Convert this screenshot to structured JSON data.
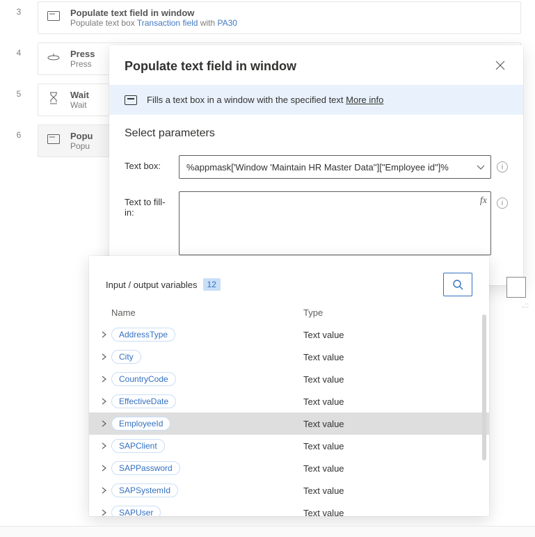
{
  "steps": [
    {
      "num": "3",
      "title": "Populate text field in window",
      "sub_prefix": "Populate text box ",
      "sub_link": "Transaction field",
      "sub_mid": " with ",
      "sub_link2": "PA30"
    },
    {
      "num": "4",
      "title": "Press",
      "sub_prefix": "Press"
    },
    {
      "num": "5",
      "title": "Wait",
      "sub_prefix": "Wait "
    },
    {
      "num": "6",
      "title": "Popu",
      "sub_prefix": "Popu"
    }
  ],
  "panel": {
    "title": "Populate text field in window",
    "info_text": "Fills a text box in a window with the specified text ",
    "info_link": "More info",
    "section": "Select parameters",
    "label_textbox": "Text box:",
    "value_textbox": "%appmask['Window 'Maintain HR Master Data''][\"Employee id\"]%",
    "label_fill": "Text to fill-in:",
    "value_fill": "",
    "fx": "fx"
  },
  "vardrop": {
    "title": "Input / output variables",
    "count": "12",
    "col_name": "Name",
    "col_type": "Type",
    "rows": [
      {
        "name": "AddressType",
        "type": "Text value",
        "sel": false
      },
      {
        "name": "City",
        "type": "Text value",
        "sel": false
      },
      {
        "name": "CountryCode",
        "type": "Text value",
        "sel": false
      },
      {
        "name": "EffectiveDate",
        "type": "Text value",
        "sel": false
      },
      {
        "name": "EmployeeId",
        "type": "Text value",
        "sel": true
      },
      {
        "name": "SAPClient",
        "type": "Text value",
        "sel": false
      },
      {
        "name": "SAPPassword",
        "type": "Text value",
        "sel": false
      },
      {
        "name": "SAPSystemId",
        "type": "Text value",
        "sel": false
      },
      {
        "name": "SAPUser",
        "type": "Text value",
        "sel": false
      }
    ]
  }
}
